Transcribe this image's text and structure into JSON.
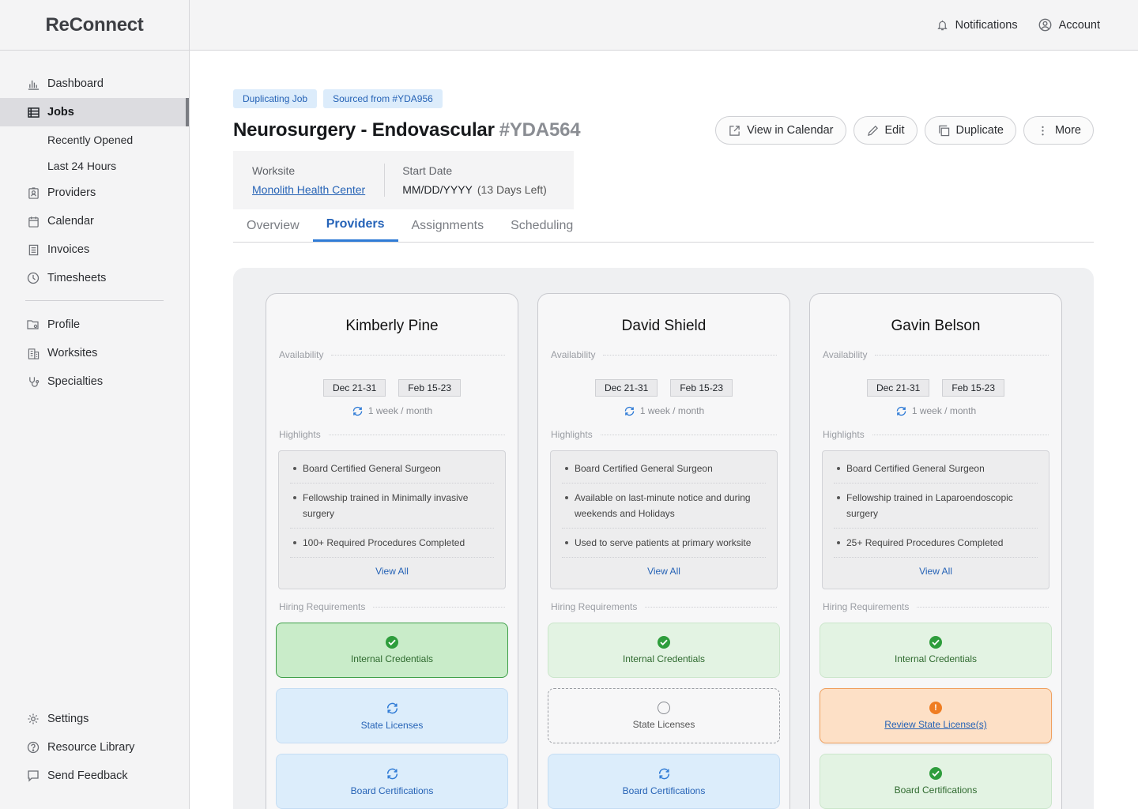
{
  "app": {
    "brand": "ReConnect"
  },
  "header": {
    "notifications": "Notifications",
    "account": "Account"
  },
  "sidebar": {
    "items": [
      {
        "label": "Dashboard",
        "icon": "bar-chart-icon"
      },
      {
        "label": "Jobs",
        "icon": "list-icon",
        "active": true
      },
      {
        "label": "Recently Opened",
        "sub": true
      },
      {
        "label": "Last 24 Hours",
        "sub": true
      },
      {
        "label": "Providers",
        "icon": "id-badge-icon"
      },
      {
        "label": "Calendar",
        "icon": "calendar-icon"
      },
      {
        "label": "Invoices",
        "icon": "document-icon"
      },
      {
        "label": "Timesheets",
        "icon": "clock-icon"
      }
    ],
    "secondary": [
      {
        "label": "Profile",
        "icon": "folder-gear-icon"
      },
      {
        "label": "Worksites",
        "icon": "building-icon"
      },
      {
        "label": "Specialties",
        "icon": "stethoscope-icon"
      }
    ],
    "bottom": [
      {
        "label": "Settings",
        "icon": "gear-icon"
      },
      {
        "label": "Resource Library",
        "icon": "help-circle-icon"
      },
      {
        "label": "Send Feedback",
        "icon": "chat-icon"
      }
    ]
  },
  "job": {
    "tags": [
      "Duplicating Job",
      "Sourced from #YDA956"
    ],
    "title": "Neurosurgery - Endovascular",
    "id": "#YDA564",
    "actions": {
      "calendar": "View in Calendar",
      "edit": "Edit",
      "duplicate": "Duplicate",
      "more": "More"
    },
    "worksite_label": "Worksite",
    "worksite_value": "Monolith Health Center",
    "start_label": "Start Date",
    "start_value": "MM/DD/YYYY",
    "start_remaining": "(13 Days Left)"
  },
  "tabs": [
    "Overview",
    "Providers",
    "Assignments",
    "Scheduling"
  ],
  "active_tab": "Providers",
  "labels": {
    "availability": "Availability",
    "highlights": "Highlights",
    "hiring": "Hiring Requirements",
    "view_all": "View All"
  },
  "providers": [
    {
      "name": "Kimberly Pine",
      "dates": [
        "Dec 21-31",
        "Feb 15-23"
      ],
      "frequency": "1 week / month",
      "highlights": [
        "Board Certified General Surgeon",
        "Fellowship trained in Minimally invasive surgery",
        "100+ Required Procedures Completed"
      ],
      "requirements": [
        {
          "label": "Internal Credentials",
          "status": "complete",
          "selected": true
        },
        {
          "label": "State Licenses",
          "status": "in-progress"
        },
        {
          "label": "Board Certifications",
          "status": "in-progress"
        }
      ]
    },
    {
      "name": "David Shield",
      "dates": [
        "Dec 21-31",
        "Feb 15-23"
      ],
      "frequency": "1 week / month",
      "highlights": [
        "Board Certified General Surgeon",
        "Available on last-minute notice and during weekends and Holidays",
        "Used to serve patients at primary worksite"
      ],
      "requirements": [
        {
          "label": "Internal Credentials",
          "status": "complete"
        },
        {
          "label": "State Licenses",
          "status": "not-started"
        },
        {
          "label": "Board Certifications",
          "status": "in-progress"
        }
      ]
    },
    {
      "name": "Gavin Belson",
      "dates": [
        "Dec 21-31",
        "Feb 15-23"
      ],
      "frequency": "1 week / month",
      "highlights": [
        "Board Certified General Surgeon",
        "Fellowship trained in Laparoendoscopic surgery",
        "25+ Required Procedures Completed"
      ],
      "requirements": [
        {
          "label": "Internal Credentials",
          "status": "complete"
        },
        {
          "label": "Review State License(s)",
          "status": "attention"
        },
        {
          "label": "Board Certifications",
          "status": "complete"
        }
      ]
    }
  ],
  "colors": {
    "accent": "#2f7bd6",
    "success": "#2e9d3c",
    "warning": "#ef7d22"
  }
}
